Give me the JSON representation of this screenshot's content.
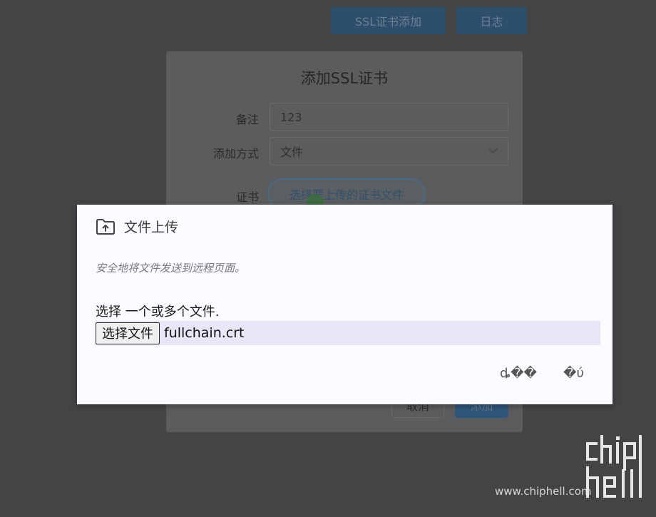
{
  "background": {
    "top_buttons": {
      "ssl_add": "SSL证书添加",
      "log": "日志"
    },
    "dialog": {
      "title": "添加SSL证书",
      "remark_label": "备注",
      "remark_value": "123",
      "method_label": "添加方式",
      "method_value": "文件",
      "cert_label": "证书",
      "cert_button": "选择要上传的证书文件",
      "cancel": "取消",
      "add": "添加"
    }
  },
  "upload_dialog": {
    "icon": "folder-upload-icon",
    "title": "文件上传",
    "description": "安全地将文件发送到远程页面。",
    "instruction": "选择 一个或多个文件.",
    "choose_button": "选择文件",
    "file_name": "fullchain.crt",
    "button_1": "ȡ��",
    "button_2": "�ύ"
  },
  "watermark": {
    "site": "www.chiphell.com",
    "logo": "chip hell"
  },
  "colors": {
    "overlay": "#434446",
    "dialog_bg": "#fbfbff",
    "file_row_bg": "#e7e7f8",
    "primary_dimmed": "#2d4e6c"
  }
}
